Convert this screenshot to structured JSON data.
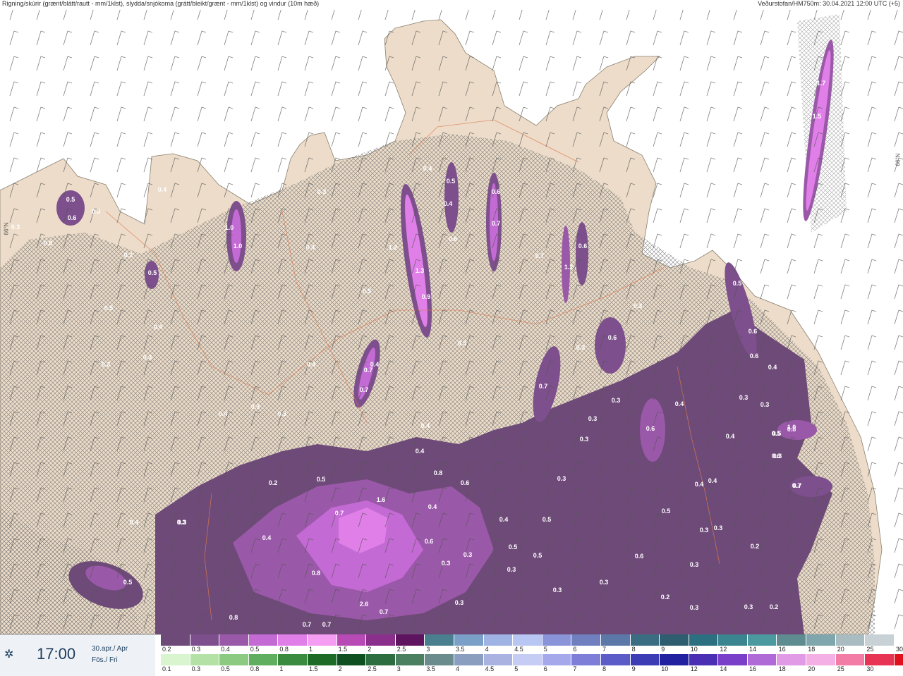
{
  "header": {
    "left": "Rigning/skúrir (grænt/blátt/rautt - mm/1klst), slydda/snjókoma (grátt/bleikt/grænt - mm/1klst) og vindur (10m hæð)",
    "right": "Veðurstofan/HM750m: 30.04.2021 12:00 UTC (+5)"
  },
  "latitude_labels": [
    "66°N",
    "66°N"
  ],
  "time": {
    "value": "17:00",
    "date_line1": "30.apr./ Apr",
    "date_line2": "Fös./ Fri"
  },
  "legend": {
    "snow_labels": [
      "0.2",
      "0.3",
      "0.4",
      "0.5",
      "0.8",
      "1",
      "1.5",
      "2",
      "2.5",
      "3",
      "3.5",
      "4",
      "4.5",
      "5",
      "6",
      "7",
      "8",
      "9",
      "10",
      "12",
      "14",
      "16",
      "18",
      "20",
      "25",
      "30"
    ],
    "snow_colors": [
      "#6e4a78",
      "#7d4f8c",
      "#9a58a8",
      "#c46ad4",
      "#e07fe8",
      "#f59df2",
      "#b84ab6",
      "#8b2f8d",
      "#5e145e",
      "#4a7f90",
      "#7aa0c8",
      "#9fb4e4",
      "#b7c6f2",
      "#8a94d8",
      "#6f7fc0",
      "#5b78a8",
      "#3a6d82",
      "#2d5d6e",
      "#2c6f80",
      "#3b8590",
      "#4a9aa0",
      "#5e8c90",
      "#7fa6ac",
      "#a8bcc2",
      "#c8d2d6",
      "#ffffff"
    ],
    "rain_labels": [
      "0.1",
      "0.3",
      "0.5",
      "0.8",
      "1",
      "1.5",
      "2",
      "2.5",
      "3",
      "3.5",
      "4",
      "4.5",
      "5",
      "6",
      "7",
      "8",
      "9",
      "10",
      "12",
      "14",
      "16",
      "18",
      "20",
      "25",
      "30"
    ],
    "rain_colors": [
      "#d9f5cf",
      "#b4e2a6",
      "#8bca80",
      "#5fae5f",
      "#3a8a3f",
      "#1e6b28",
      "#0f5020",
      "#2d6e40",
      "#4a7f60",
      "#6a8c8c",
      "#8a9ec0",
      "#aab2e2",
      "#c6cdf4",
      "#a6a8ec",
      "#7e7ed8",
      "#5c5cc8",
      "#3c3cb4",
      "#2222a0",
      "#4a2fb4",
      "#7a3fc8",
      "#b06ad8",
      "#e09ae6",
      "#f4b0e4",
      "#f27ca6",
      "#e83454",
      "#e0101c"
    ]
  },
  "value_labels": [
    "0.3",
    "0.5",
    "0.6",
    "0.3",
    "0.8",
    "0.2",
    "0.4",
    "0.5",
    "0.3",
    "0.4",
    "0.3",
    "0.5",
    "0.4",
    "0.3",
    "0.4",
    "1.0",
    "1.0",
    "0.4",
    "0.3",
    "0.3",
    "0.5",
    "0.4",
    "0.7",
    "0.7",
    "0.4",
    "0.2",
    "0.3",
    "1.2",
    "1.3",
    "0.9",
    "0.4",
    "0.5",
    "0.4",
    "0.6",
    "0.7",
    "0.3",
    "0.6",
    "1.2",
    "0.6",
    "0.7",
    "0.4",
    "0.7",
    "1.6",
    "0.4",
    "0.8",
    "0.6",
    "0.5",
    "0.3",
    "0.3",
    "0.6",
    "0.3",
    "0.3",
    "0.4",
    "0.6",
    "0.3",
    "0.4",
    "0.5",
    "0.6",
    "0.3",
    "0.5",
    "0.3",
    "0.6",
    "0.8",
    "0.6",
    "0.4",
    "0.3",
    "0.2",
    "1.0",
    "0.5",
    "0.3",
    "0.7",
    "0.4",
    "0.4",
    "0.3",
    "0.3",
    "0.3",
    "0.5",
    "0.6",
    "0.2",
    "0.3",
    "0.3",
    "0.3",
    "0.7",
    "0.5",
    "0.5",
    "0.3",
    "0.4",
    "0.6",
    "0.8",
    "0.7",
    "0.3",
    "2.6",
    "0.7",
    "0.7",
    "0.7",
    "0.8",
    "0.3",
    "0.5",
    "0.4",
    "0.5",
    "0.3",
    "0.3",
    "0.2",
    "0.3",
    "0.4",
    "1.7",
    "1.5"
  ]
}
